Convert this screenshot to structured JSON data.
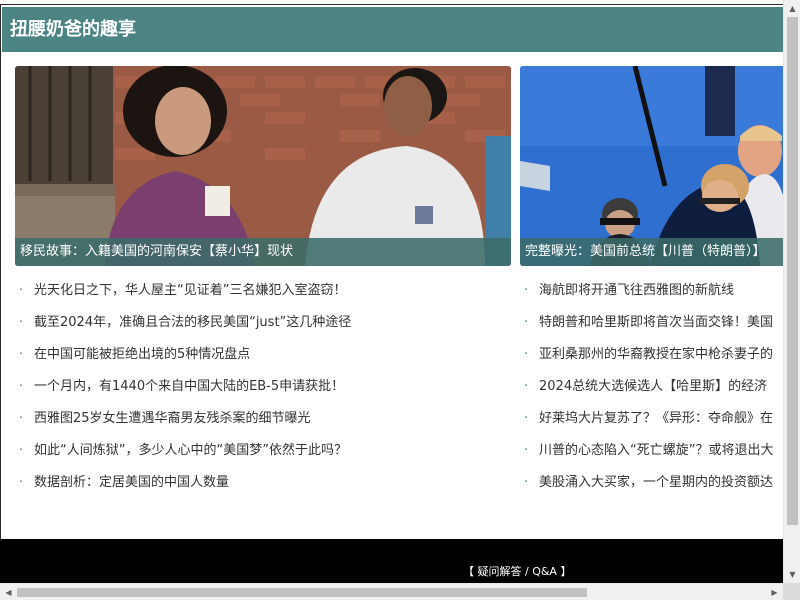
{
  "header": {
    "title": "扭腰奶爸的趣享"
  },
  "featured": [
    {
      "caption": "移民故事：入籍美国的河南保安【蔡小华】现状"
    },
    {
      "caption": "完整曝光：美国前总统【川普（特朗普）】"
    }
  ],
  "news_left": [
    "光天化日之下，华人屋主“见证着”三名嫌犯入室盗窃！",
    "截至2024年，准确且合法的移民美国“just”这几种途径",
    "在中国可能被拒绝出境的5种情况盘点",
    "一个月内，有1440个来自中国大陆的EB-5申请获批！",
    "西雅图25岁女生遭遇华裔男友残杀案的细节曝光",
    "如此“人间炼狱”，多少人心中的“美国梦”依然于此吗？",
    "数据剖析：定居美国的中国人数量"
  ],
  "news_right": [
    "海航即将开通飞往西雅图的新航线",
    "特朗普和哈里斯即将首次当面交锋！美国",
    "亚利桑那州的华裔教授在家中枪杀妻子的",
    "2024总统大选候选人【哈里斯】的经济",
    "好莱坞大片复苏了？《异形：夺命舰》在",
    "川普的心态陷入“死亡螺旋”？或将退出大",
    "美股涌入大买家，一个星期内的投资额达"
  ],
  "footer": {
    "link_label": "【 疑问解答 / Q&A 】"
  },
  "icons": {
    "bullet": "·",
    "up": "▲",
    "down": "▼",
    "left": "◀",
    "right": "▶"
  },
  "colors": {
    "header_bg": "#4b8482",
    "caption_bg": "#3c6c6a",
    "footer_bg": "#000000"
  }
}
